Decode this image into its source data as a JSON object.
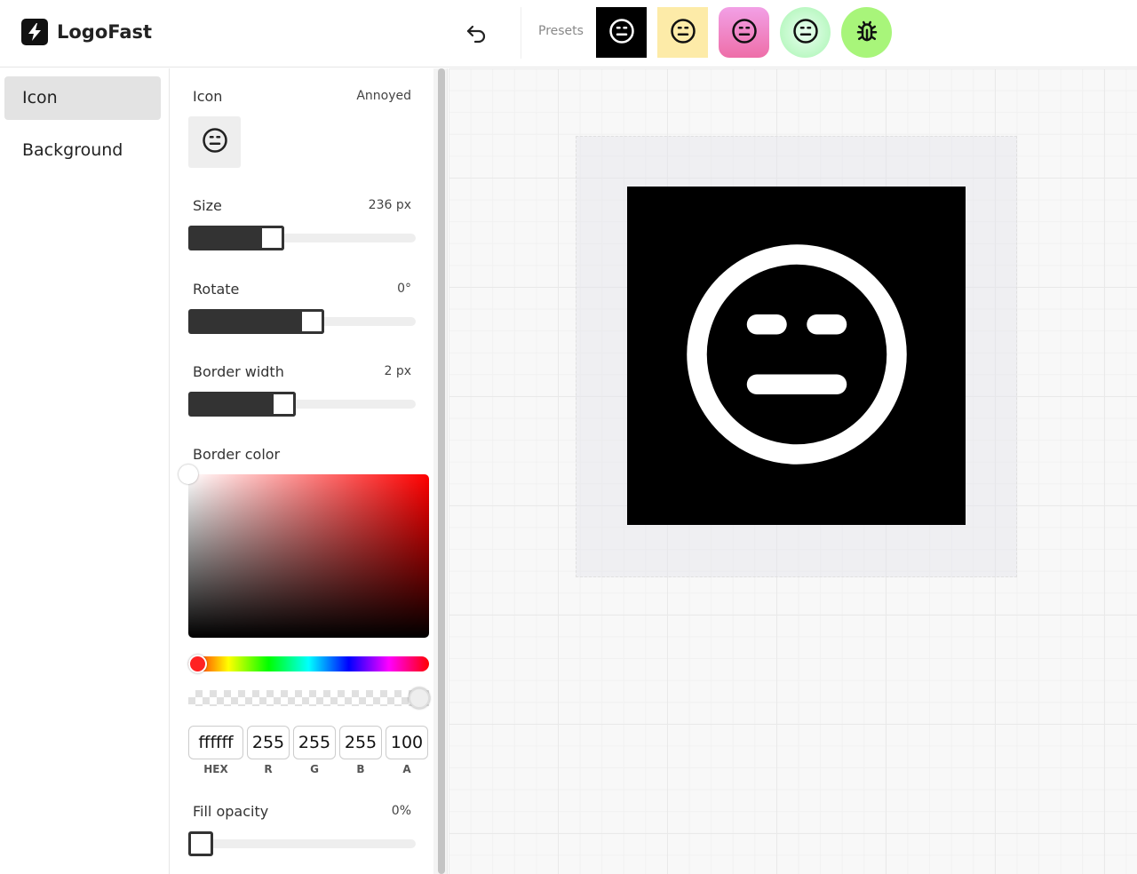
{
  "app": {
    "name": "LogoFast"
  },
  "header": {
    "presets_label": "Presets",
    "presets": [
      {
        "bg": "#000000",
        "fg": "#ffffff",
        "icon": "annoyed-face-icon",
        "shape": "square"
      },
      {
        "bg": "#fdeba8",
        "fg": "#111111",
        "icon": "annoyed-face-icon",
        "shape": "square"
      },
      {
        "bg": "linear-gradient(#f2a0e6,#ee6ea8)",
        "fg": "#111111",
        "icon": "annoyed-face-icon",
        "shape": "rounded"
      },
      {
        "bg": "radial-gradient(#e8fff0,#a8f5b0)",
        "fg": "#111111",
        "icon": "annoyed-face-icon",
        "shape": "circle"
      },
      {
        "bg": "#a8f57a",
        "fg": "#111111",
        "icon": "bug-icon",
        "shape": "circle"
      }
    ]
  },
  "sidebar": {
    "items": [
      {
        "label": "Icon",
        "active": true
      },
      {
        "label": "Background",
        "active": false
      }
    ]
  },
  "panel": {
    "icon": {
      "label": "Icon",
      "value": "Annoyed"
    },
    "size": {
      "label": "Size",
      "value": "236 px",
      "fraction": 0.35
    },
    "rotate": {
      "label": "Rotate",
      "value": "0°",
      "fraction": 0.55
    },
    "border_width": {
      "label": "Border width",
      "value": "2 px",
      "fraction": 0.41
    },
    "border_color": {
      "label": "Border color",
      "hex": "ffffff",
      "r": "255",
      "g": "255",
      "b": "255",
      "a": "100",
      "labels": {
        "hex": "HEX",
        "r": "R",
        "g": "G",
        "b": "B",
        "a": "A"
      },
      "hue_color": "#ff0000"
    },
    "fill_opacity": {
      "label": "Fill opacity",
      "value": "0%",
      "fraction": 0
    }
  },
  "canvas": {
    "background": "#000000",
    "icon_color": "#ffffff"
  }
}
